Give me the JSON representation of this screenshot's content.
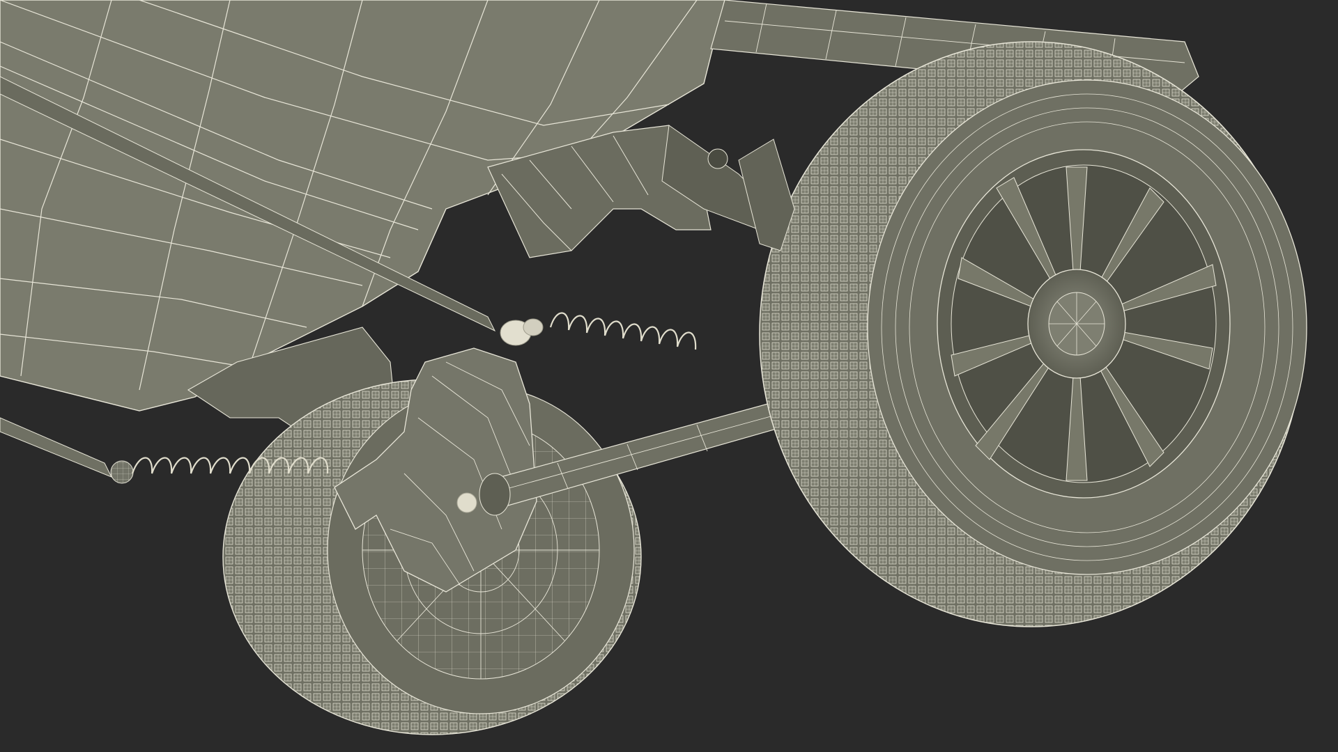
{
  "scene": {
    "subject": "",
    "render_style": "",
    "colors": {
      "background": "#2a2a2a",
      "surface": "#77786a",
      "surface_light": "#8a8b7d",
      "surface_dark": "#5b5c50",
      "wire": "#e8e6d8",
      "shadow": "#3a3b33"
    },
    "icons": {}
  }
}
